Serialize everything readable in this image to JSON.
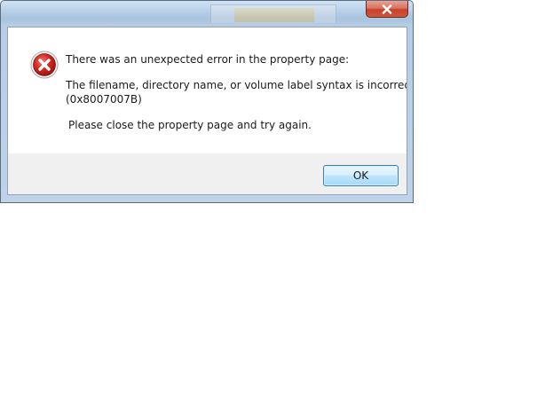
{
  "dialog": {
    "close_icon": "close-x-icon",
    "error_icon": "error-x-circle-icon",
    "message": {
      "headline": "There was an unexpected error in the property page:",
      "detail_line1": "The filename, directory name, or volume label syntax is incorrect.",
      "detail_line2": "(0x8007007B)",
      "instruction": "Please close the property page and try again."
    },
    "ok_label": "OK"
  },
  "colors": {
    "close_button": "#c7402a",
    "error_icon": "#d2261f",
    "ok_border": "#3c7fb1",
    "button_panel": "#f0f0f0"
  }
}
